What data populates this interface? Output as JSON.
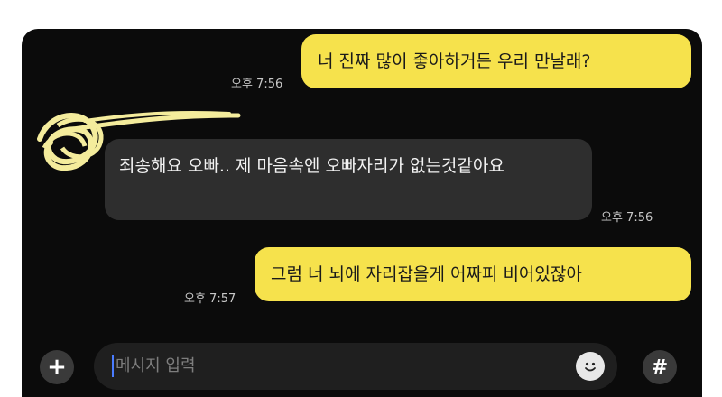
{
  "messages": [
    {
      "sender": "me",
      "text": "너 진짜 많이 좋아하거든 우리 만날래?",
      "time": "오후 7:56"
    },
    {
      "sender": "other",
      "text": "죄송해요 오빠.. 제 마음속엔 오빠자리가 없는것같아요",
      "time": "오후 7:56"
    },
    {
      "sender": "me",
      "text": "그럼 너 뇌에 자리잡을게 어짜피 비어있잖아",
      "time": "오후 7:57"
    }
  ],
  "composer": {
    "plus_icon": "plus-icon",
    "placeholder": "메시지 입력",
    "emoji_icon": "emoji-icon",
    "hash_icon": "hash-icon",
    "plus_glyph": "+",
    "hash_glyph": "#"
  },
  "colors": {
    "background": "#0b0b0b",
    "my_bubble": "#f6e24c",
    "their_bubble": "#2e2e2e",
    "timestamp": "#c8c8c8"
  }
}
